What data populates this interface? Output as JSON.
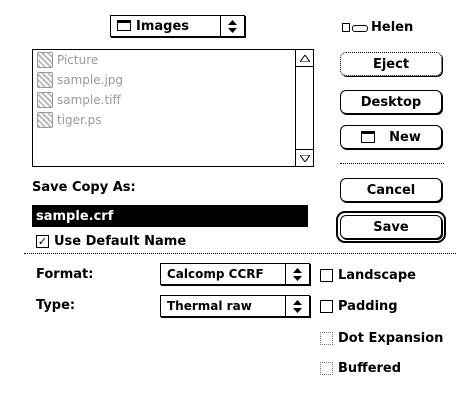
{
  "folder_popup": {
    "label": "Images",
    "icon": "folder-icon",
    "arrow": "↕"
  },
  "volume": {
    "label": "Helen",
    "icon": "disk-icon"
  },
  "files": [
    {
      "name": "Picture",
      "icon": "image-file-icon"
    },
    {
      "name": "sample.jpg",
      "icon": "image-file-icon"
    },
    {
      "name": "sample.tiff",
      "icon": "image-file-icon"
    },
    {
      "name": "tiger.ps",
      "icon": "image-file-icon"
    }
  ],
  "buttons": {
    "eject": "Eject",
    "desktop": "Desktop",
    "new": "New",
    "cancel": "Cancel",
    "save": "Save"
  },
  "save_as": {
    "label": "Save Copy As:",
    "value": "sample.crf"
  },
  "use_default_name": {
    "label": "Use Default Name",
    "checked": true
  },
  "format": {
    "label": "Format:",
    "value": "Calcomp CCRF"
  },
  "type": {
    "label": "Type:",
    "value": "Thermal raw"
  },
  "options": {
    "landscape": "Landscape",
    "padding": "Padding",
    "dot_expansion": "Dot Expansion",
    "buffered": "Buffered"
  },
  "glyphs": {
    "check": "✓",
    "up": "△",
    "down": "▽",
    "updown": "⬍"
  }
}
